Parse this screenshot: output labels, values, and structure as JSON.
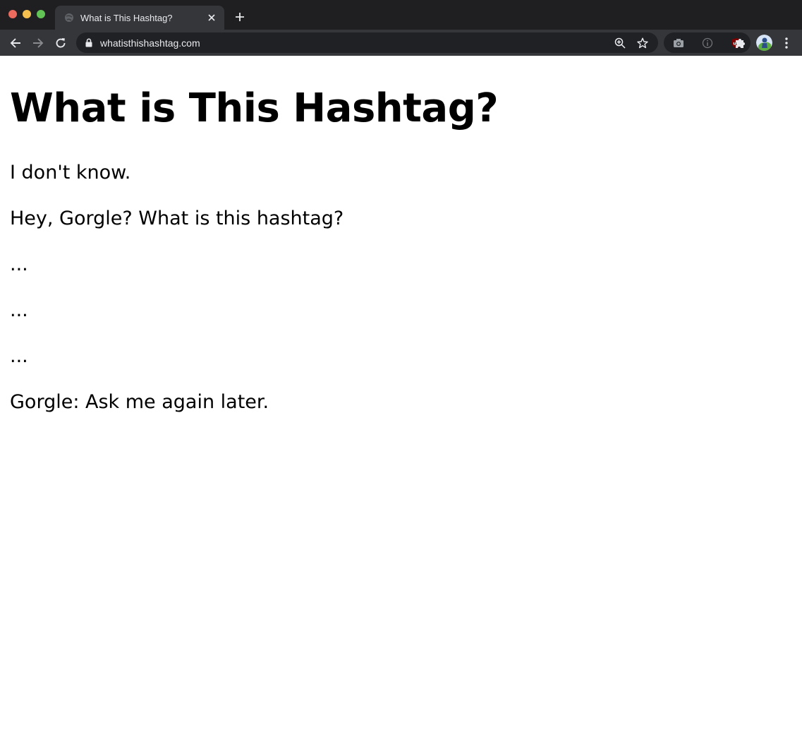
{
  "browser": {
    "tab_title": "What is This Hashtag?",
    "url": "whatisthishashtag.com",
    "icons": {
      "tab_favicon": "globe-icon",
      "tab_close": "close-icon",
      "new_tab": "plus-icon",
      "back": "arrow-left-icon",
      "forward": "arrow-right-icon",
      "reload": "reload-icon",
      "lock": "lock-icon",
      "zoom": "zoom-icon",
      "bookmark": "star-icon",
      "extensions": [
        "camera-icon",
        "info-icon",
        "ublock-icon"
      ],
      "puzzle": "puzzle-icon",
      "profile": "avatar-icon",
      "menu": "kebab-menu-icon"
    },
    "colors": {
      "frame": "#202124",
      "toolbar": "#35363a",
      "ublock": "#800000"
    }
  },
  "page": {
    "heading": "What is This Hashtag?",
    "lines": [
      "I don't know.",
      "Hey, Gorgle? What is this hashtag?",
      "...",
      "...",
      "...",
      "Gorgle: Ask me again later."
    ]
  }
}
